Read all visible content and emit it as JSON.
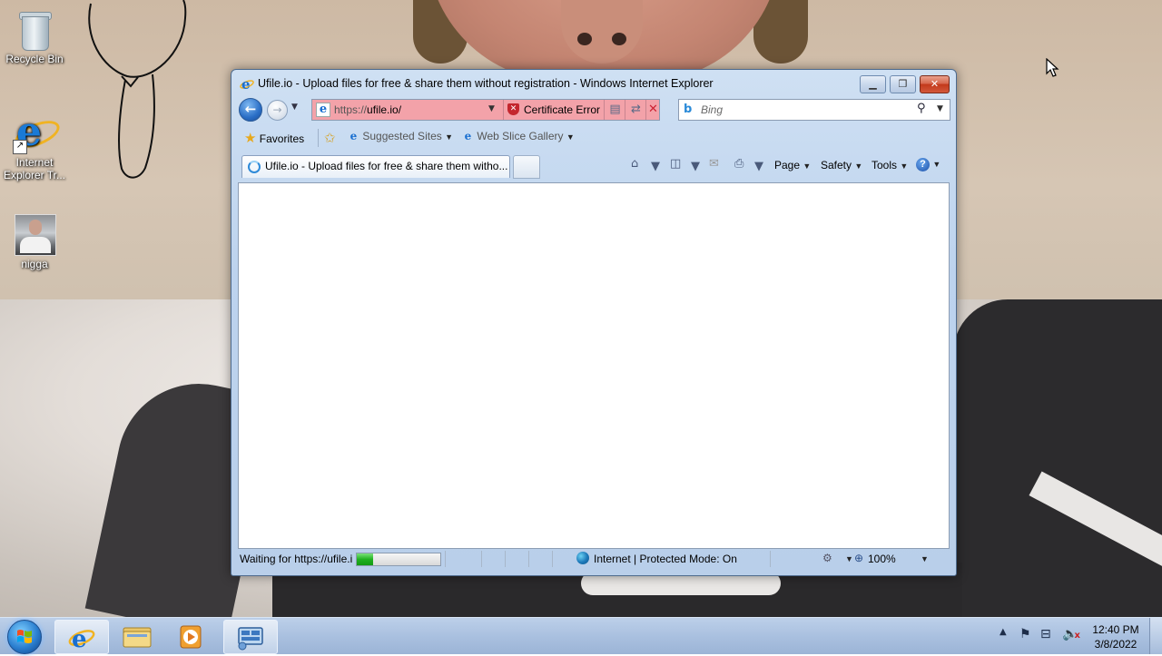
{
  "desktop": {
    "icons": [
      {
        "label": "Recycle Bin"
      },
      {
        "label": "Internet Explorer Tr..."
      },
      {
        "label": "nigga"
      }
    ]
  },
  "window": {
    "title": "Ufile.io - Upload files for free & share them without registration - Windows Internet Explorer",
    "address": {
      "prefix": "https://",
      "host": "ufile.io/"
    },
    "certificate_error": "Certificate Error",
    "search_placeholder": "Bing",
    "favorites_bar": {
      "favorites": "Favorites",
      "suggested_sites": "Suggested Sites",
      "web_slice_gallery": "Web Slice Gallery"
    },
    "tab": {
      "title": "Ufile.io - Upload files for free & share them witho..."
    },
    "command_bar": {
      "page": "Page",
      "safety": "Safety",
      "tools": "Tools"
    },
    "status": {
      "text": "Waiting for https://ufile.io/",
      "progress": 0.2,
      "zone": "Internet | Protected Mode: On",
      "zoom": "100%"
    }
  },
  "taskbar": {
    "clock": {
      "time": "12:40 PM",
      "date": "3/8/2022"
    }
  },
  "colors": {
    "address_error_bg": "#f3a2a9",
    "progress_green": "#21b021",
    "window_frame": "#bdd3ee"
  }
}
